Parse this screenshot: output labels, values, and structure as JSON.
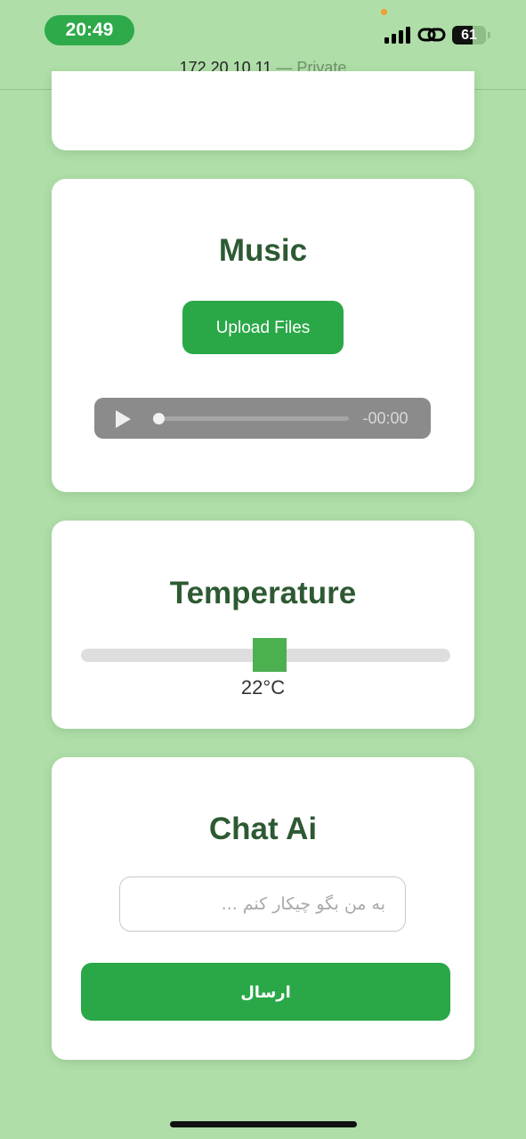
{
  "status_bar": {
    "time": "20:49",
    "battery": "61",
    "battery_level_percent": 61,
    "icons": [
      "signal-bars-icon",
      "personal-hotspot-icon",
      "battery-icon"
    ]
  },
  "url_bar": {
    "host": "172.20.10.11",
    "separator": "—",
    "mode": "Private"
  },
  "music": {
    "title": "Music",
    "upload_label": "Upload Files",
    "time_remaining": "-00:00",
    "progress_percent": 0
  },
  "temperature": {
    "title": "Temperature",
    "value_label": "22°C",
    "slider_position_percent": 50
  },
  "chat": {
    "title": "Chat Ai",
    "input_placeholder": "به من بگو چیکار کنم ...",
    "input_value": "",
    "send_label": "ارسال"
  },
  "colors": {
    "page_background": "#afdea8",
    "accent_green": "#2aa848",
    "title_green": "#2d5a32",
    "slider_thumb": "#4caf50"
  }
}
